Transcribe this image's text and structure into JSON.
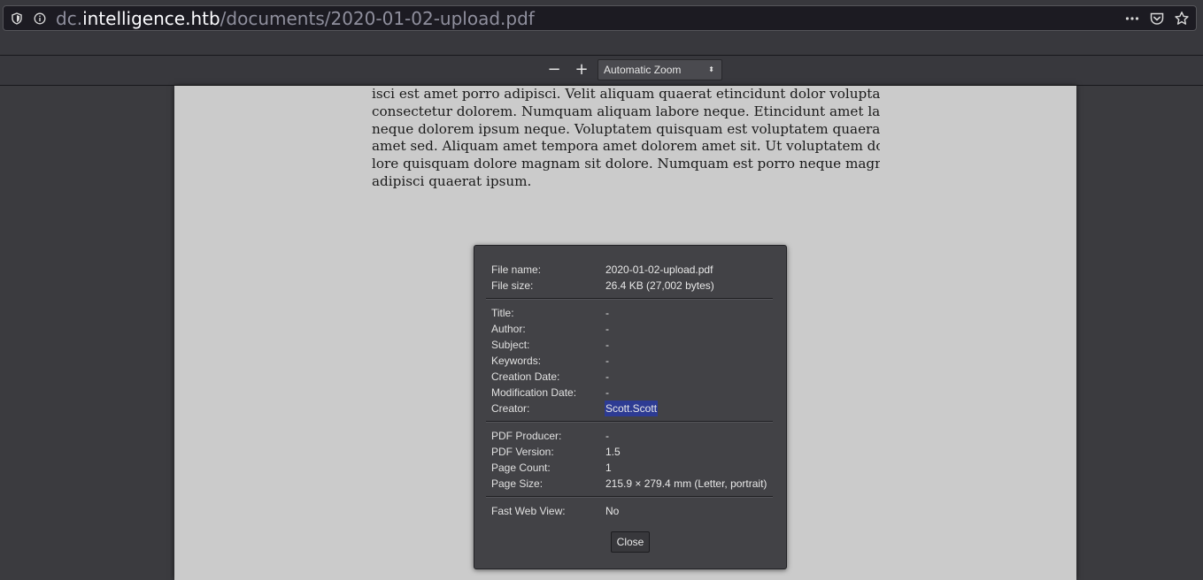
{
  "browser": {
    "url_host_prefix": "dc.",
    "url_host": "intelligence.htb",
    "url_path": "/documents/2020-01-02-upload.pdf",
    "icons": [
      "shield-icon",
      "info-icon",
      "more-icon",
      "pocket-icon",
      "bookmark-star-icon"
    ]
  },
  "pdf_toolbar": {
    "zoom_out": "−",
    "zoom_in": "+",
    "zoom_value": "Automatic Zoom",
    "zoom_arrow": "⬍"
  },
  "page": {
    "lines": [
      "isci est amet porro adipisci. Velit aliquam quaerat etincidunt dolor voluptatem",
      "consectetur dolorem. Numquam aliquam labore neque. Etincidunt amet labore",
      "neque dolorem ipsum neque.  Voluptatem quisquam est voluptatem quaerat",
      "amet sed.  Aliquam amet tempora amet dolorem amet sit.  Ut voluptatem do-",
      "lore quisquam dolore magnam sit dolore.  Numquam est porro neque magnam",
      "adipisci quaerat ipsum."
    ]
  },
  "dialog": {
    "file_name_label": "File name:",
    "file_name": "2020-01-02-upload.pdf",
    "file_size_label": "File size:",
    "file_size": "26.4 KB (27,002 bytes)",
    "title_label": "Title:",
    "title": "-",
    "author_label": "Author:",
    "author": "-",
    "subject_label": "Subject:",
    "subject": "-",
    "keywords_label": "Keywords:",
    "keywords": "-",
    "creation_date_label": "Creation Date:",
    "creation_date": "-",
    "modification_date_label": "Modification Date:",
    "modification_date": "-",
    "creator_label": "Creator:",
    "creator": "Scott.Scott",
    "producer_label": "PDF Producer:",
    "producer": "-",
    "version_label": "PDF Version:",
    "version": "1.5",
    "page_count_label": "Page Count:",
    "page_count": "1",
    "page_size_label": "Page Size:",
    "page_size": "215.9 × 279.4 mm (Letter, portrait)",
    "fast_web_view_label": "Fast Web View:",
    "fast_web_view": "No",
    "close_label": "Close"
  }
}
